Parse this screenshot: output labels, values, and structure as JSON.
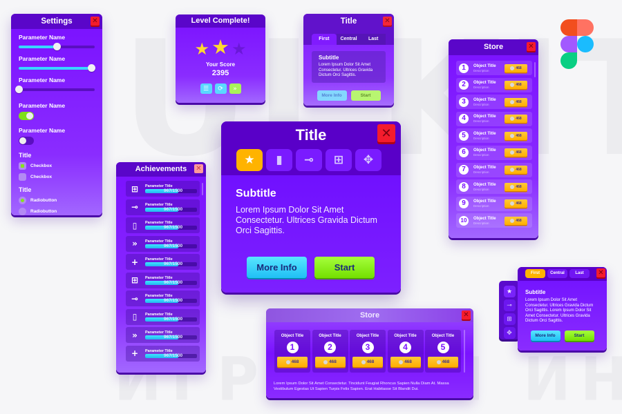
{
  "watermark": {
    "top": "UI KIT",
    "bottom": "ИГРОВОЙ ИНТЕРФЕЙС"
  },
  "colors": {
    "primary": "#7a10ff",
    "header": "#5900c8",
    "close": "#f41c2d",
    "cyan": "#38d6ff",
    "green": "#86e21c",
    "gold": "#ffb300"
  },
  "settings": {
    "title": "Settings",
    "sliders": [
      {
        "label": "Parameter Name",
        "value": 0.5
      },
      {
        "label": "Parameter Name",
        "value": 0.95
      },
      {
        "label": "Parameter Name",
        "value": 0.0
      }
    ],
    "toggles": [
      {
        "label": "Parameter Name",
        "on": true
      },
      {
        "label": "Parameter Name",
        "on": false
      }
    ],
    "checkbox_group": {
      "title": "Title",
      "items": [
        {
          "label": "Checkbox",
          "checked": true
        },
        {
          "label": "Checkbox",
          "checked": false
        }
      ]
    },
    "radio_group": {
      "title": "Title",
      "items": [
        {
          "label": "Radiobutton",
          "selected": true
        },
        {
          "label": "Radiobutton",
          "selected": false
        }
      ]
    }
  },
  "level": {
    "title": "Level Complete!",
    "stars_earned": 2,
    "stars_total": 3,
    "score_label": "Your Score",
    "score": "2395",
    "buttons": [
      {
        "icon": "list-icon",
        "glyph": "☰"
      },
      {
        "icon": "refresh-icon",
        "glyph": "⟳"
      },
      {
        "icon": "next-icon",
        "glyph": "»"
      }
    ]
  },
  "title_small": {
    "title": "Title",
    "tabs": [
      "First",
      "Central",
      "Last"
    ],
    "active_tab": 0,
    "subtitle": "Subtitle",
    "text": "Lorem Ipsum Dolor Sit Amet Consectetur. Ultrices Gravida Dictum Orci Sagittis.",
    "more_info": "More Info",
    "start": "Start"
  },
  "store_vertical": {
    "title": "Store",
    "items": [
      {
        "n": "1",
        "title": "Object Title",
        "desc": "Description",
        "price": "468"
      },
      {
        "n": "2",
        "title": "Object Title",
        "desc": "Description",
        "price": "468"
      },
      {
        "n": "3",
        "title": "Object Title",
        "desc": "Description",
        "price": "468"
      },
      {
        "n": "4",
        "title": "Object Title",
        "desc": "Description",
        "price": "468"
      },
      {
        "n": "5",
        "title": "Object Title",
        "desc": "Description",
        "price": "468"
      },
      {
        "n": "6",
        "title": "Object Title",
        "desc": "Description",
        "price": "468"
      },
      {
        "n": "7",
        "title": "Object Title",
        "desc": "Description",
        "price": "468"
      },
      {
        "n": "8",
        "title": "Object Title",
        "desc": "Description",
        "price": "468"
      },
      {
        "n": "9",
        "title": "Object Title",
        "desc": "Description",
        "price": "468"
      },
      {
        "n": "10",
        "title": "Object Title",
        "desc": "Description",
        "price": "468"
      }
    ]
  },
  "achievements": {
    "title": "Achievements",
    "items": [
      {
        "icon": "robot-icon",
        "glyph": "⊞",
        "title": "Parameter Title",
        "progress": "967/1500",
        "fraction": 0.645
      },
      {
        "icon": "key-icon",
        "glyph": "⊸",
        "title": "Parameter Title",
        "progress": "967/1500",
        "fraction": 0.645
      },
      {
        "icon": "map-icon",
        "glyph": "▯",
        "title": "Parameter Title",
        "progress": "967/1500",
        "fraction": 0.645
      },
      {
        "icon": "chevrons-icon",
        "glyph": "»",
        "title": "Parameter Title",
        "progress": "967/1500",
        "fraction": 0.645
      },
      {
        "icon": "plus-icon",
        "glyph": "+",
        "title": "Parameter Title",
        "progress": "967/1500",
        "fraction": 0.645
      },
      {
        "icon": "robot-icon",
        "glyph": "⊞",
        "title": "Parameter Title",
        "progress": "967/1500",
        "fraction": 0.645
      },
      {
        "icon": "key-icon",
        "glyph": "⊸",
        "title": "Parameter Title",
        "progress": "967/1500",
        "fraction": 0.645
      },
      {
        "icon": "map-icon",
        "glyph": "▯",
        "title": "Parameter Title",
        "progress": "967/1500",
        "fraction": 0.645
      },
      {
        "icon": "chevrons-icon",
        "glyph": "»",
        "title": "Parameter Title",
        "progress": "967/1500",
        "fraction": 0.645
      },
      {
        "icon": "plus-icon",
        "glyph": "+",
        "title": "Parameter Title",
        "progress": "967/1500",
        "fraction": 0.645
      }
    ]
  },
  "main_dialog": {
    "title": "Title",
    "tabs": [
      {
        "icon": "star-icon",
        "glyph": "★"
      },
      {
        "icon": "map-icon",
        "glyph": "▮"
      },
      {
        "icon": "key-icon",
        "glyph": "⊸"
      },
      {
        "icon": "robot-icon",
        "glyph": "⊞"
      },
      {
        "icon": "gamepad-icon",
        "glyph": "✥"
      }
    ],
    "active_tab": 0,
    "subtitle": "Subtitle",
    "text": "Lorem Ipsum Dolor Sit Amet Consectetur. Ultrices Gravida Dictum Orci Sagittis.",
    "more_info": "More Info",
    "start": "Start"
  },
  "store_horizontal": {
    "title": "Store",
    "items": [
      {
        "title": "Object Title",
        "n": "1",
        "price": "468"
      },
      {
        "title": "Object Title",
        "n": "2",
        "price": "468"
      },
      {
        "title": "Object Title",
        "n": "3",
        "price": "468"
      },
      {
        "title": "Object Title",
        "n": "4",
        "price": "468"
      },
      {
        "title": "Object Title",
        "n": "5",
        "price": "468"
      }
    ],
    "text": "Lorem Ipsum Dolor Sit Amet Consectetur. Tincidunt Feugiat Rhoncus Sapien Nulla Diam At. Massa Vestibulum Egestas Ut Sapien Turpis Felis Sapien. Erat Habitasse Sit Blandit Dui."
  },
  "tabbed_dialog": {
    "tabs": [
      "First",
      "Central",
      "Last"
    ],
    "active_tab": 0,
    "side_icons": [
      {
        "icon": "star-icon",
        "glyph": "★"
      },
      {
        "icon": "key-icon",
        "glyph": "⊸"
      },
      {
        "icon": "robot-icon",
        "glyph": "⊞"
      },
      {
        "icon": "gamepad-icon",
        "glyph": "✥"
      }
    ],
    "subtitle": "Subtitle",
    "text": "Lorem Ipsum Dolor Sit Amet Consectetur. Ultrices Gravida Dictum Orci Sagittis. Lorem Ipsum Dolor Sit Amet Consectetur. Ultrices Gravida Dictum Orci Sagittis.",
    "more_info": "More Info",
    "start": "Start"
  },
  "close_glyph": "✕"
}
